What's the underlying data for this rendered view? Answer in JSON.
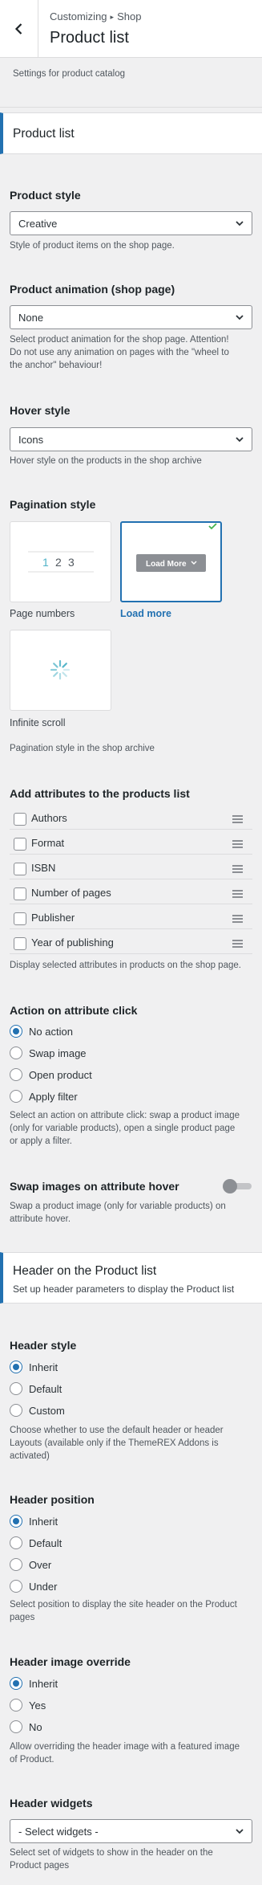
{
  "header": {
    "breadcrumb_parent": "Customizing",
    "breadcrumb_separator": "▸",
    "breadcrumb_child": "Shop",
    "title": "Product list",
    "description": "Settings for product catalog"
  },
  "section_product_list": {
    "title": "Product list"
  },
  "product_style": {
    "title": "Product style",
    "value": "Creative",
    "description": "Style of product items on the shop page."
  },
  "product_animation": {
    "title": "Product animation (shop page)",
    "value": "None",
    "description_1": "Select product animation for the shop page. Attention!",
    "description_2": "Do not use any animation on pages with the \"wheel to",
    "description_3": "the anchor\" behaviour!"
  },
  "hover_style": {
    "title": "Hover style",
    "value": "Icons",
    "description": "Hover style on the products in the shop archive"
  },
  "pagination_style": {
    "title": "Pagination style",
    "page_numbers": {
      "label": "Page numbers",
      "n1": "1",
      "n2": "2",
      "n3": "3"
    },
    "load_more": {
      "label": "Load more",
      "button": "Load More"
    },
    "infinite_scroll": {
      "label": "Infinite scroll"
    },
    "description": "Pagination style in the shop archive"
  },
  "attributes": {
    "title": "Add attributes to the products list",
    "items": [
      {
        "label": "Authors"
      },
      {
        "label": "Format"
      },
      {
        "label": "ISBN"
      },
      {
        "label": "Number of pages"
      },
      {
        "label": "Publisher"
      },
      {
        "label": "Year of publishing"
      }
    ],
    "description": "Display selected attributes in products on the shop page."
  },
  "attribute_click": {
    "title": "Action on attribute click",
    "options": [
      "No action",
      "Swap image",
      "Open product",
      "Apply filter"
    ],
    "selected": "No action",
    "description_1": "Select an action on attribute click: swap a product image",
    "description_2": "(only for variable products), open a single product page",
    "description_3": "or apply a filter."
  },
  "swap_images": {
    "title": "Swap images on attribute hover",
    "enabled": false,
    "description_1": "Swap a product image (only for variable products) on",
    "description_2": "attribute hover."
  },
  "section_header": {
    "title": "Header on the Product list",
    "subtitle": "Set up header parameters to display the Product list"
  },
  "header_style": {
    "title": "Header style",
    "options": [
      "Inherit",
      "Default",
      "Custom"
    ],
    "selected": "Inherit",
    "description_1": "Choose whether to use the default header or header",
    "description_2": "Layouts (available only if the ThemeREX Addons is",
    "description_3": "activated)"
  },
  "header_position": {
    "title": "Header position",
    "options": [
      "Inherit",
      "Default",
      "Over",
      "Under"
    ],
    "selected": "Inherit",
    "description_1": "Select position to display the site header on the Product",
    "description_2": "pages"
  },
  "header_image_override": {
    "title": "Header image override",
    "options": [
      "Inherit",
      "Yes",
      "No"
    ],
    "selected": "Inherit",
    "description_1": "Allow overriding the header image with a featured image",
    "description_2": "of Product."
  },
  "header_widgets": {
    "title": "Header widgets",
    "value": "- Select widgets -",
    "description_1": "Select set of widgets to show in the header on the",
    "description_2": "Product pages"
  },
  "colors": {
    "accent": "#2271b1",
    "spinner": "#4fb3c8",
    "check": "#46b450"
  }
}
